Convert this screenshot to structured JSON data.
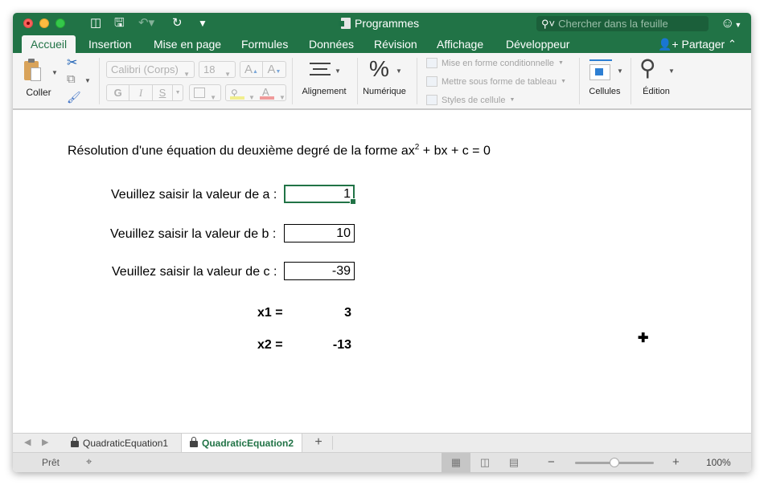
{
  "window": {
    "title": "Programmes",
    "search_placeholder": "Chercher dans la feuille"
  },
  "ribbon_tabs": [
    {
      "label": "Accueil",
      "active": true
    },
    {
      "label": "Insertion",
      "active": false
    },
    {
      "label": "Mise en page",
      "active": false
    },
    {
      "label": "Formules",
      "active": false
    },
    {
      "label": "Données",
      "active": false
    },
    {
      "label": "Révision",
      "active": false
    },
    {
      "label": "Affichage",
      "active": false
    },
    {
      "label": "Développeur",
      "active": false
    }
  ],
  "share_label": "Partager",
  "ribbon": {
    "paste_label": "Coller",
    "font_name": "Calibri (Corps)",
    "font_size": "18",
    "bold": "G",
    "italic": "I",
    "underline": "S",
    "grow_font": "A",
    "shrink_font": "A",
    "font_color": "A",
    "alignment_label": "Alignement",
    "number_label": "Numérique",
    "number_icon": "%",
    "conditional_format": "Mise en forme conditionnelle",
    "format_as_table": "Mettre sous forme de tableau",
    "cell_styles": "Styles de cellule",
    "cells_label": "Cellules",
    "editing_label": "Édition"
  },
  "sheet": {
    "title_prefix": "Résolution d'une équation du deuxième degré de la forme ax",
    "title_sup": "2",
    "title_suffix": " + bx + c = 0",
    "inputs": [
      {
        "label": "Veuillez saisir la valeur de a :",
        "value": "1"
      },
      {
        "label": "Veuillez saisir la valeur de b :",
        "value": "10"
      },
      {
        "label": "Veuillez saisir la valeur de c :",
        "value": "-39"
      }
    ],
    "results": [
      {
        "label": "x1 =",
        "value": "3"
      },
      {
        "label": "x2 =",
        "value": "-13"
      }
    ]
  },
  "sheet_tabs": [
    {
      "label": "QuadraticEquation1",
      "active": false
    },
    {
      "label": "QuadraticEquation2",
      "active": true
    }
  ],
  "status": {
    "state": "Prêt",
    "zoom": "100%",
    "zoom_fraction": 0.5
  },
  "colors": {
    "accent": "#217346"
  }
}
